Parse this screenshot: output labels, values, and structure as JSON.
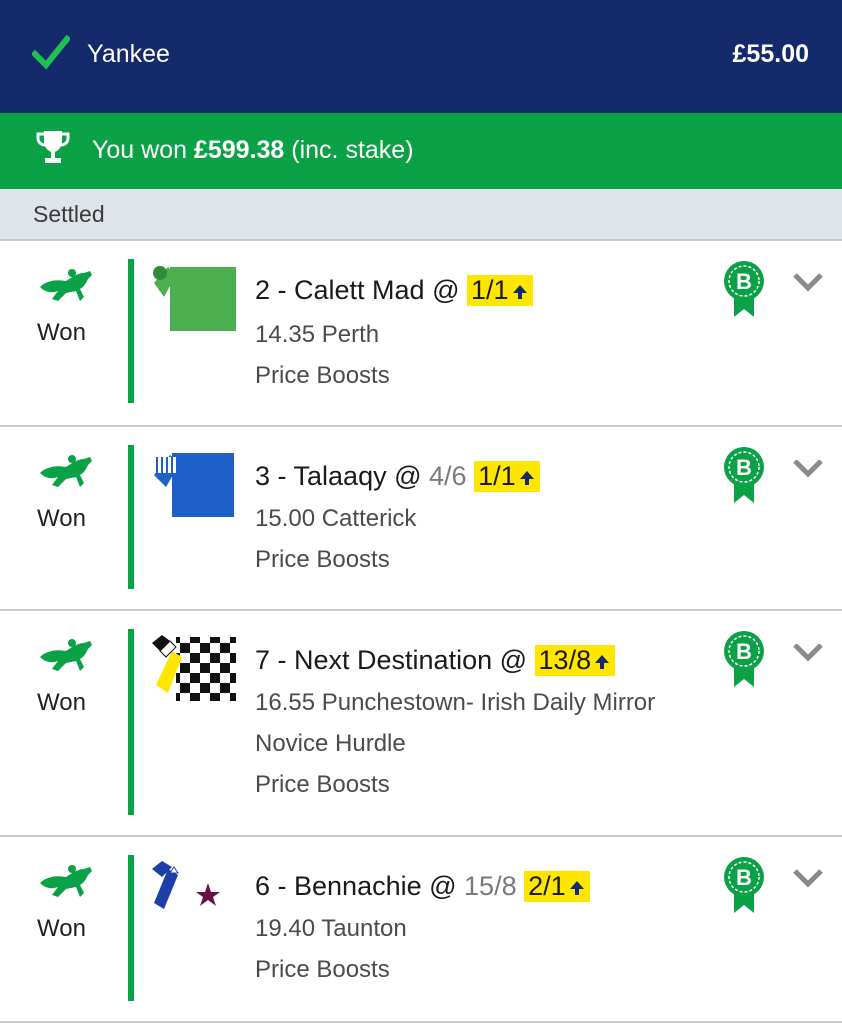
{
  "header": {
    "title": "Yankee",
    "stake": "£55.00",
    "check_icon": "checkmark-icon"
  },
  "win_banner": {
    "prefix": "You won ",
    "amount": "£599.38",
    "suffix": " (inc. stake)",
    "icon": "trophy-icon"
  },
  "section": {
    "label": "Settled"
  },
  "colors": {
    "navy": "#152a6b",
    "green": "#0ba146",
    "boost_yellow": "#ffe600"
  },
  "selections": [
    {
      "result": "Won",
      "number_name": "2 - Calett Mad @ ",
      "old_price": "",
      "boosted_price": "1/1",
      "time_venue": "14.35 Perth",
      "race_extra": "",
      "market": "Price Boosts",
      "badge_letter": "B"
    },
    {
      "result": "Won",
      "number_name": "3 - Talaaqy @ ",
      "old_price": "4/6",
      "boosted_price": "1/1",
      "time_venue": "15.00 Catterick",
      "race_extra": "",
      "market": "Price Boosts",
      "badge_letter": "B"
    },
    {
      "result": "Won",
      "number_name": "7 - Next Destination @ ",
      "old_price": "",
      "boosted_price": "13/8",
      "time_venue": "16.55 Punchestown- Irish Daily Mirror",
      "race_extra": "Novice Hurdle",
      "market": "Price Boosts",
      "badge_letter": "B"
    },
    {
      "result": "Won",
      "number_name": "6 - Bennachie @ ",
      "old_price": "15/8",
      "boosted_price": "2/1",
      "time_venue": "19.40 Taunton",
      "race_extra": "",
      "market": "Price Boosts",
      "badge_letter": "B"
    }
  ]
}
